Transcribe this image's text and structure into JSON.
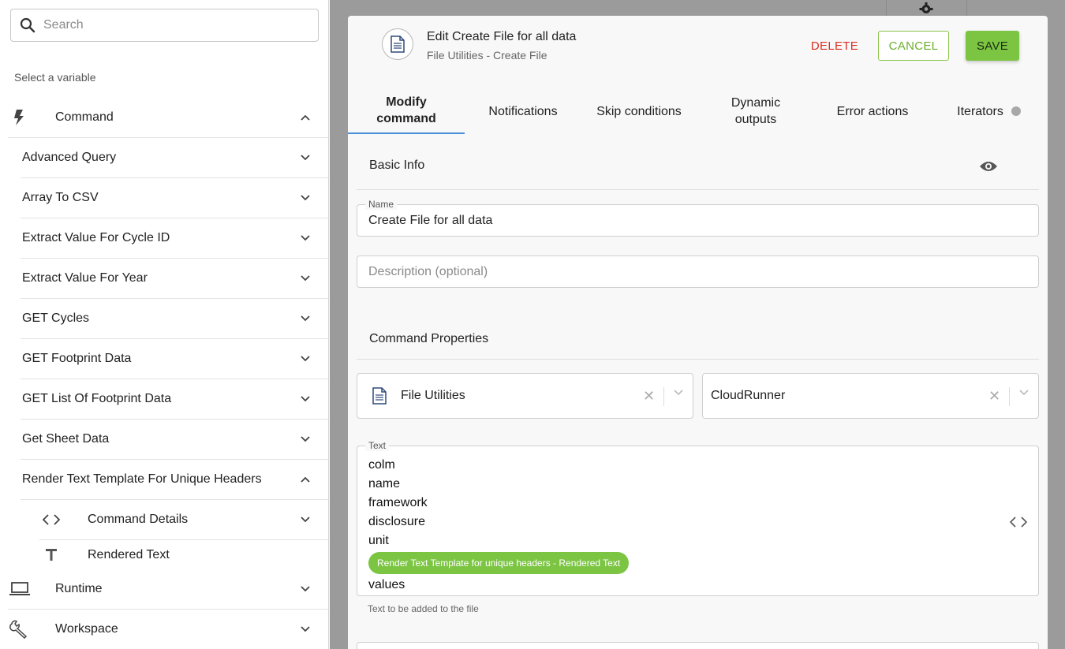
{
  "search": {
    "placeholder": "Search"
  },
  "sidebar": {
    "heading": "Select a variable",
    "sections": {
      "command": "Command",
      "runtime": "Runtime",
      "workspace": "Workspace"
    },
    "items": [
      "Advanced Query",
      "Array To CSV",
      "Extract Value For Cycle ID",
      "Extract Value For Year",
      "GET Cycles",
      "GET Footprint Data",
      "GET List Of Footprint Data",
      "Get Sheet Data",
      "Render Text Template For Unique Headers"
    ],
    "subitems": {
      "command_details": "Command Details",
      "rendered_text": "Rendered Text"
    }
  },
  "modal": {
    "title": "Edit Create File for all data",
    "subtitle": "File Utilities - Create File",
    "buttons": {
      "delete": "DELETE",
      "cancel": "CANCEL",
      "save": "SAVE"
    },
    "tabs": {
      "modify_line1": "Modify",
      "modify_line2": "command",
      "notifications": "Notifications",
      "skip": "Skip conditions",
      "dynamic_line1": "Dynamic",
      "dynamic_line2": "outputs",
      "error": "Error actions",
      "iterators": "Iterators"
    },
    "basic_info": {
      "title": "Basic Info",
      "name_label": "Name",
      "name_value": "Create File for all data",
      "description_placeholder": "Description (optional)"
    },
    "command_properties": {
      "title": "Command Properties",
      "command_select": "File Utilities",
      "runner_select": "CloudRunner",
      "text_label": "Text",
      "text_lines": [
        "colm",
        "name",
        "framework",
        "disclosure",
        "unit"
      ],
      "chip": "Render Text Template for unique headers - Rendered Text",
      "text_last": "values",
      "helper": "Text to be added to the file"
    }
  },
  "colors": {
    "accent_green": "#7cc543",
    "delete_red": "#d93025",
    "tab_underline": "#4a90d9"
  }
}
